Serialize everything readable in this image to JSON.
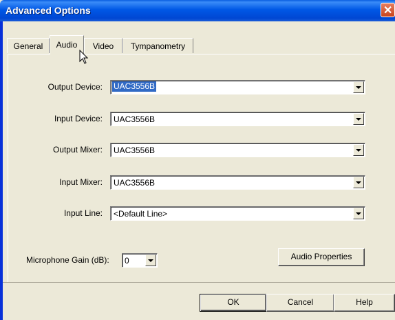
{
  "window": {
    "title": "Advanced Options",
    "close_glyph": "✕"
  },
  "tabs": [
    {
      "label": "General",
      "active": false
    },
    {
      "label": "Audio",
      "active": true
    },
    {
      "label": "Video",
      "active": false
    },
    {
      "label": "Tympanometry",
      "active": false
    }
  ],
  "fields": {
    "output_device": {
      "label": "Output Device:",
      "value": "UAC3556B",
      "selected": true
    },
    "input_device": {
      "label": "Input Device:",
      "value": "UAC3556B"
    },
    "output_mixer": {
      "label": "Output Mixer:",
      "value": "UAC3556B"
    },
    "input_mixer": {
      "label": "Input Mixer:",
      "value": "UAC3556B"
    },
    "input_line": {
      "label": "Input Line:",
      "value": "<Default Line>"
    },
    "mic_gain": {
      "label": "Microphone Gain (dB):",
      "value": "0"
    }
  },
  "buttons": {
    "audio_properties": "Audio Properties",
    "ok": "OK",
    "cancel": "Cancel",
    "help": "Help"
  },
  "icons": {
    "close": "close-icon",
    "dropdown": "chevron-down-icon",
    "cursor": "arrow-cursor"
  }
}
